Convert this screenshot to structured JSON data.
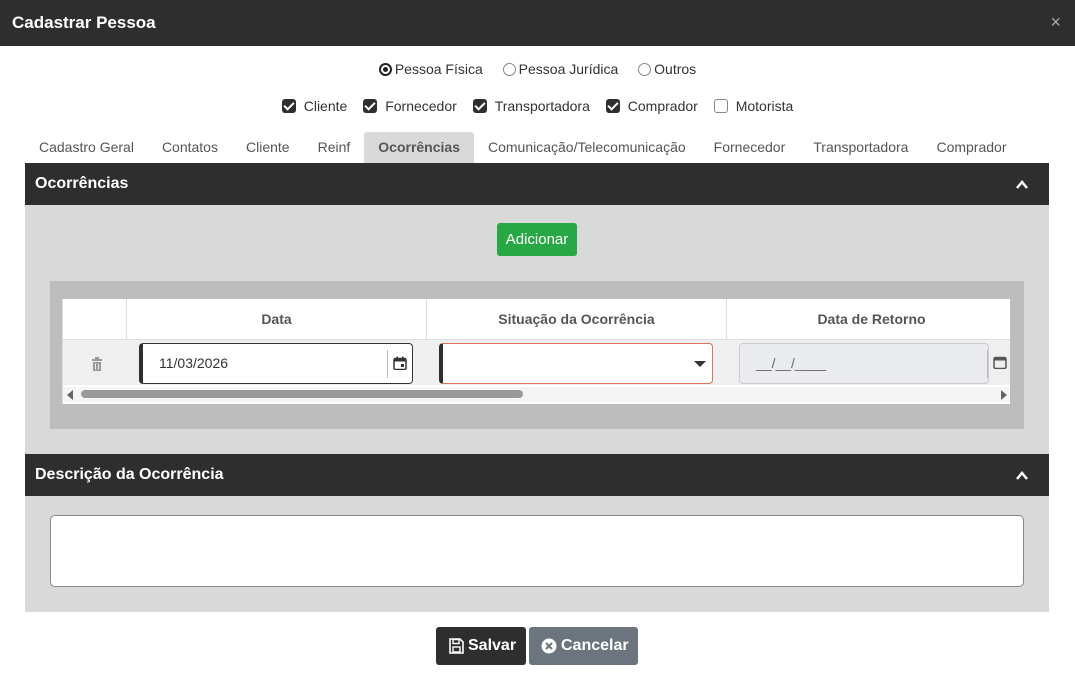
{
  "dialog": {
    "title": "Cadastrar Pessoa",
    "close_glyph": "×"
  },
  "person_type": {
    "options": [
      {
        "label": "Pessoa Física",
        "checked": true
      },
      {
        "label": "Pessoa Jurídica",
        "checked": false
      },
      {
        "label": "Outros",
        "checked": false
      }
    ]
  },
  "roles": {
    "options": [
      {
        "label": "Cliente",
        "checked": true
      },
      {
        "label": "Fornecedor",
        "checked": true
      },
      {
        "label": "Transportadora",
        "checked": true
      },
      {
        "label": "Comprador",
        "checked": true
      },
      {
        "label": "Motorista",
        "checked": false
      }
    ]
  },
  "tabs": [
    {
      "label": "Cadastro Geral",
      "active": false
    },
    {
      "label": "Contatos",
      "active": false
    },
    {
      "label": "Cliente",
      "active": false
    },
    {
      "label": "Reinf",
      "active": false
    },
    {
      "label": "Ocorrências",
      "active": true
    },
    {
      "label": "Comunicação/Telecomunicação",
      "active": false
    },
    {
      "label": "Fornecedor",
      "active": false
    },
    {
      "label": "Transportadora",
      "active": false
    },
    {
      "label": "Comprador",
      "active": false
    }
  ],
  "occurrences_panel": {
    "title": "Ocorrências",
    "add_button": "Adicionar",
    "columns": [
      "Data",
      "Situação da Ocorrência",
      "Data de Retorno"
    ],
    "rows": [
      {
        "date": "11/03/2026",
        "situation": "",
        "return_date_placeholder": "__/__/____"
      }
    ]
  },
  "description_panel": {
    "title": "Descrição da Ocorrência",
    "value": ""
  },
  "footer": {
    "save_label": "Salvar",
    "cancel_label": "Cancelar"
  },
  "colors": {
    "header": "#2e2e2e",
    "panel": "#d9d9d9",
    "add": "#28a745",
    "cancel": "#6c757d",
    "invalid_border": "#e07060"
  }
}
